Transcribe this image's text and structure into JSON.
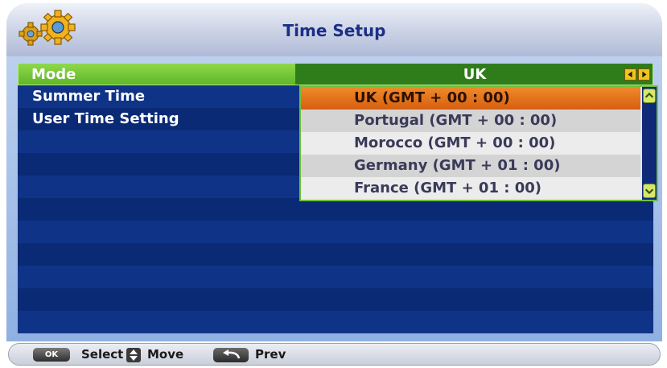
{
  "header": {
    "title": "Time Setup"
  },
  "menu": {
    "mode": {
      "label": "Mode",
      "value": "UK"
    },
    "items": [
      {
        "label": "Summer Time"
      },
      {
        "label": "User Time Setting"
      }
    ]
  },
  "dropdown": {
    "options": [
      {
        "label": "UK (GMT + 00 : 00)",
        "selected": true
      },
      {
        "label": "Portugal (GMT + 00 : 00)",
        "selected": false
      },
      {
        "label": "Morocco (GMT + 00 : 00)",
        "selected": false
      },
      {
        "label": "Germany (GMT + 01 : 00)",
        "selected": false
      },
      {
        "label": "France (GMT + 01 : 00)",
        "selected": false
      }
    ]
  },
  "footer": {
    "ok_label": "OK",
    "select_label": "Select",
    "move_label": "Move",
    "prev_label": "Prev"
  },
  "colors": {
    "header_title": "#1b2f86",
    "selected_row": "#5fb62a",
    "dropdown_selected": "#e5741c",
    "list_background": "#0a2a76"
  }
}
